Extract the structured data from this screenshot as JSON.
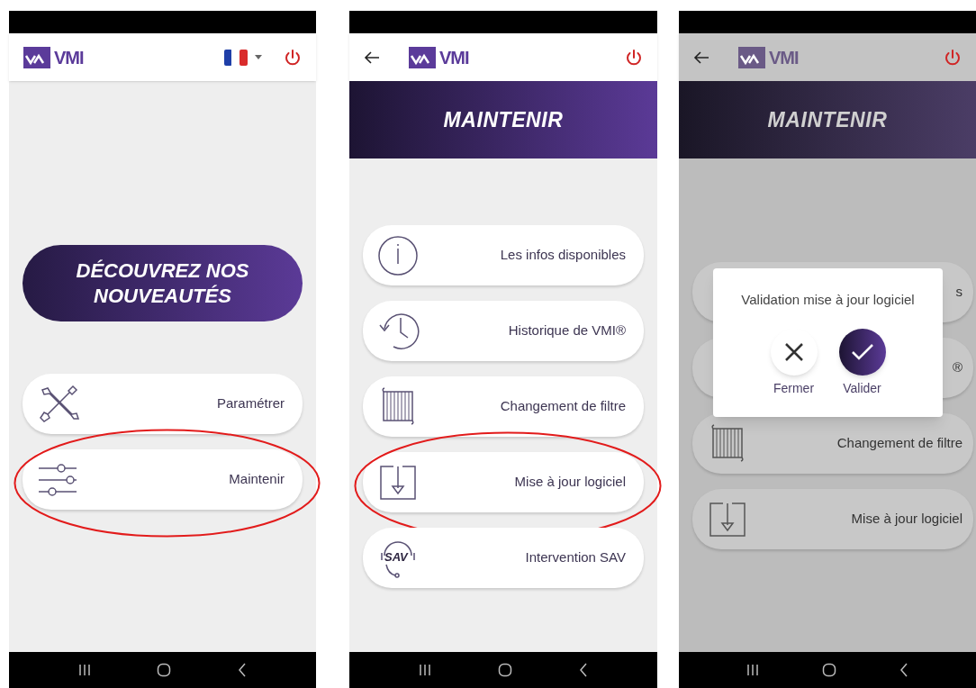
{
  "screens": [
    {
      "kind": "home",
      "dimmed": false,
      "header": {
        "back": false,
        "logo_text": "VMI",
        "language_menu": true
      },
      "promo_button": "DÉCOUVREZ NOS NOUVEAUTÉS",
      "items": [
        {
          "label": "Paramétrer",
          "kind": "tools",
          "highlighted": false
        },
        {
          "label": "Maintenir",
          "kind": "sliders",
          "highlighted": true
        }
      ]
    },
    {
      "kind": "menu",
      "dimmed": false,
      "header": {
        "back": true,
        "logo_text": "VMI",
        "language_menu": false
      },
      "banner": "MAINTENIR",
      "items": [
        {
          "label": "Les infos disponibles",
          "kind": "info",
          "highlighted": false
        },
        {
          "label": "Historique de VMI®",
          "kind": "history",
          "highlighted": false
        },
        {
          "label": "Changement de filtre",
          "kind": "filter",
          "highlighted": false
        },
        {
          "label": "Mise à jour logiciel",
          "kind": "download",
          "highlighted": true
        },
        {
          "label": "Intervention SAV",
          "kind": "headset",
          "icon_text": "SAV",
          "highlighted": false
        }
      ]
    },
    {
      "kind": "menu",
      "dimmed": true,
      "header": {
        "back": true,
        "logo_text": "VMI",
        "language_menu": false
      },
      "banner": "MAINTENIR",
      "items": [
        {
          "label": "s",
          "highlighted": false
        },
        {
          "label": "®",
          "highlighted": false
        },
        {
          "label": "Changement de filtre",
          "kind": "filter",
          "highlighted": false
        },
        {
          "label": "Mise à jour logiciel",
          "kind": "download",
          "highlighted": false
        }
      ],
      "dialog": {
        "title": "Validation mise à jour logiciel",
        "buttons": [
          {
            "label": "Fermer",
            "kind": "close"
          },
          {
            "label": "Valider",
            "kind": "confirm"
          }
        ]
      }
    }
  ]
}
